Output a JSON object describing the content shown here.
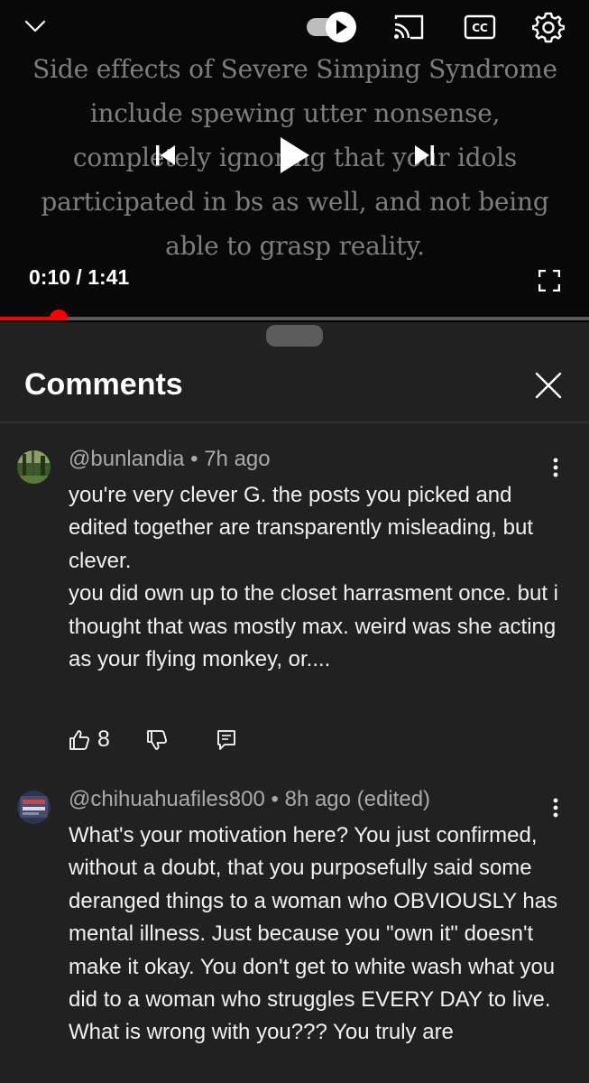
{
  "player": {
    "overlay_lines": [
      "Side effects of Severe Simping Syndrome",
      "include spewing utter nonsense,",
      "completely ignoring that your idols",
      "participated in bs as well, and not being",
      "able to grasp reality."
    ],
    "current_time": "0:10",
    "duration": "1:41",
    "time_display": "0:10 / 1:41",
    "progress": 0.099,
    "autoplay_on": true,
    "icons": {
      "collapse": "chevron-down-icon",
      "autoplay": "autoplay-toggle-icon",
      "cast": "cast-icon",
      "captions": "cc-icon",
      "settings": "gear-icon",
      "previous": "previous-icon",
      "play": "play-icon",
      "next": "next-icon",
      "fullscreen": "fullscreen-icon"
    },
    "colors": {
      "progress": "#ff0000",
      "overlay_text": "#7d7d7d"
    }
  },
  "comments_panel": {
    "title": "Comments",
    "close_icon": "close-icon",
    "comments": [
      {
        "author": "@bunlandia",
        "age": "7h ago",
        "meta": "@bunlandia • 7h ago",
        "lines": [
          "you're very clever G.  the posts you picked and edited together are transparently misleading, but clever.",
          "you did own up to the closet harrasment once. but i thought that was mostly max. weird was she acting as your flying monkey, or...."
        ],
        "likes": "8"
      },
      {
        "author": "@chihuahuafiles800",
        "age": "8h ago",
        "edited": "(edited)",
        "meta": "@chihuahuafiles800 • 8h ago (edited)",
        "lines": [
          "What's your motivation here? You just confirmed, without a doubt, that you purposefully said some deranged things to a woman who OBVIOUSLY has mental illness. Just because you \"own it\" doesn't make it okay. You don't get to white wash what you did to a woman who struggles EVERY DAY to live. What is wrong with you??? You truly are"
        ]
      }
    ]
  }
}
